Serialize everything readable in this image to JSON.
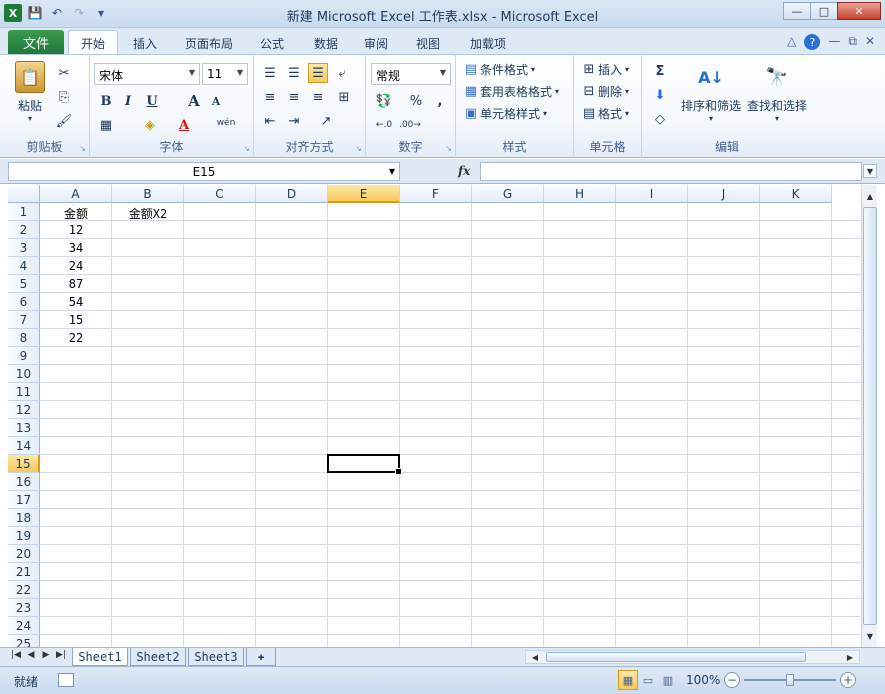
{
  "titlebar": {
    "title": "新建 Microsoft Excel 工作表.xlsx  -  Microsoft Excel",
    "app_icon": "X",
    "qat": {
      "save_icon": "💾",
      "undo_icon": "↶",
      "redo_icon": "↷",
      "customize_icon": "▾"
    },
    "controls": {
      "minimize": "—",
      "maximize": "□",
      "close": "✕"
    }
  },
  "tabs": {
    "file": "文件",
    "items": [
      "开始",
      "插入",
      "页面布局",
      "公式",
      "数据",
      "审阅",
      "视图",
      "加载项"
    ],
    "active": "开始",
    "right_icons": {
      "collapse": "△",
      "help": "?",
      "min": "—",
      "restore": "⧉",
      "close": "✕"
    }
  },
  "ribbon": {
    "clipboard": {
      "label": "剪贴板",
      "paste": "粘贴",
      "cut_icon": "✂",
      "copy_icon": "⎘",
      "format_painter_icon": "🖌"
    },
    "font": {
      "label": "字体",
      "font_name": "宋体",
      "font_size": "11",
      "bold": "B",
      "italic": "I",
      "underline": "U",
      "grow": "A",
      "shrink": "A",
      "border_icon": "▦",
      "fill_icon": "◈",
      "color": "A",
      "phonetic": "wén"
    },
    "alignment": {
      "label": "对齐方式"
    },
    "number": {
      "label": "数字",
      "format": "常规",
      "percent": "%",
      "comma": ","
    },
    "styles": {
      "label": "样式",
      "conditional": "条件格式",
      "table": "套用表格格式",
      "cell_styles": "单元格样式"
    },
    "cells": {
      "label": "单元格",
      "insert": "插入",
      "delete": "删除",
      "format": "格式"
    },
    "editing": {
      "label": "编辑",
      "sum_icon": "Σ",
      "sort": "排序和筛选",
      "find": "查找和选择"
    }
  },
  "formula_bar": {
    "name_box": "E15",
    "fx": "fx",
    "value": ""
  },
  "grid": {
    "columns": [
      "A",
      "B",
      "C",
      "D",
      "E",
      "F",
      "G",
      "H",
      "I",
      "J",
      "K"
    ],
    "rows": [
      "1",
      "2",
      "3",
      "4",
      "5",
      "6",
      "7",
      "8",
      "9",
      "10",
      "11",
      "12",
      "13",
      "14",
      "15",
      "16",
      "17",
      "18",
      "19",
      "20",
      "21",
      "22",
      "23",
      "24",
      "25"
    ],
    "selected_column": "E",
    "selected_row": "15",
    "cells": {
      "A1": "金额",
      "B1": "金额X2",
      "A2": "12",
      "A3": "34",
      "A4": "24",
      "A5": "87",
      "A6": "54",
      "A7": "15",
      "A8": "22"
    }
  },
  "sheets": {
    "tabs": [
      "Sheet1",
      "Sheet2",
      "Sheet3"
    ],
    "active": "Sheet1"
  },
  "status": {
    "text": "就绪",
    "zoom": "100%"
  }
}
